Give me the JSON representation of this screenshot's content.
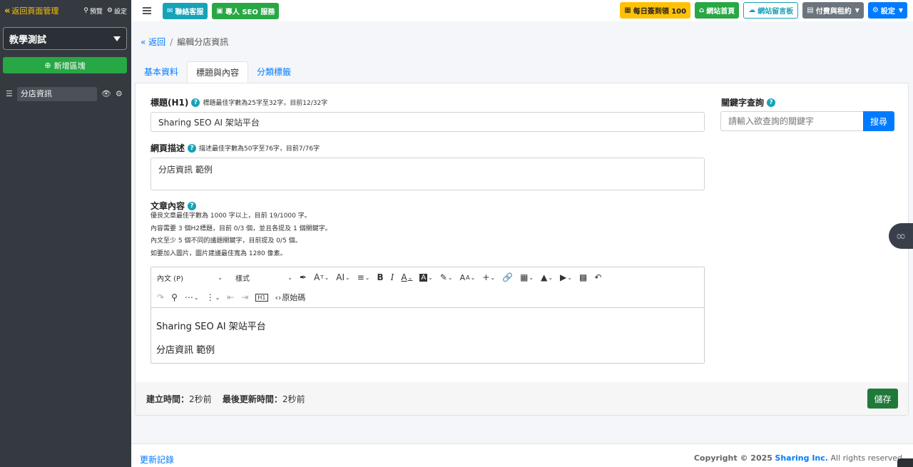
{
  "sidebar": {
    "back_label": "返回頁面管理",
    "preview_label": "預覽",
    "settings_label": "設定",
    "site_select": "教學測試",
    "add_block_label": "新增區塊",
    "items": [
      {
        "label": "分店資訊"
      }
    ]
  },
  "topbar": {
    "contact_label": "聯絡客服",
    "seo_label": "專人 SEO 服務",
    "checkin_label": "每日簽到領 100",
    "home_label": "網站首頁",
    "guestbook_label": "網站留言板",
    "billing_label": "付費與租約",
    "settings_label": "設定"
  },
  "breadcrumb": {
    "back": "返回",
    "separator": "/",
    "current": "編輯分店資訊"
  },
  "tabs": [
    {
      "label": "基本資料",
      "active": false
    },
    {
      "label": "標題與內容",
      "active": true
    },
    {
      "label": "分類標籤",
      "active": false
    }
  ],
  "form": {
    "title_label": "標題(H1)",
    "title_hint": "標題最佳字數為25字至32字，目前12/32字",
    "title_value": "Sharing SEO AI 架站平台",
    "desc_label": "網頁描述",
    "desc_hint": "描述最佳字數為50字至76字，目前7/76字",
    "desc_value": "分店資訊 範例",
    "content_label": "文章內容",
    "content_rules": [
      "優良文章最佳字數為 1000 字以上，目前 19/1000 字。",
      "內容需要 3 個H2標題，目前 0/3 個，並且各提及 1 個關鍵字。",
      "內文至少 5 個不同的議題關鍵字，目前提及 0/5 個。",
      "如要加入圖片，圖片建議最佳寬為 1280 像素。"
    ]
  },
  "editor": {
    "paragraph_select": "內文 (P)",
    "style_select": "樣式",
    "source_label": "原始碼",
    "content_lines": [
      "Sharing SEO AI 架站平台",
      "分店資訊 範例"
    ]
  },
  "keyword": {
    "label": "關鍵字查詢",
    "placeholder": "請輸入欲查詢的關鍵字",
    "search_label": "搜尋"
  },
  "meta": {
    "created_label": "建立時間：",
    "created_value": "2秒前",
    "updated_label": "最後更新時間：",
    "updated_value": "2秒前",
    "save_label": "儲存"
  },
  "footer": {
    "changelog": "更新記錄",
    "copyright_prefix": "Copyright © 2025",
    "company": "Sharing Inc.",
    "rights": "All rights reserved"
  },
  "colors": {
    "accent": "#007bff",
    "success": "#28a745",
    "info": "#17a2b8",
    "warning": "#ffc107",
    "sidebar": "#343a40"
  }
}
